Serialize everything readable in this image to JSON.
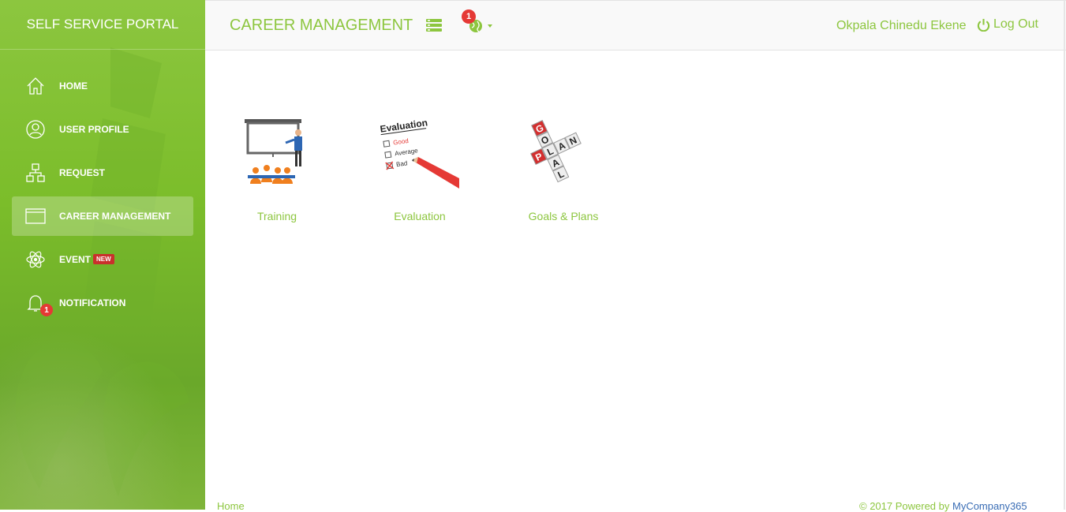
{
  "brand": {
    "title": "SELF SERVICE PORTAL"
  },
  "sidebar": {
    "items": [
      {
        "label": "HOME",
        "icon": "home-icon"
      },
      {
        "label": "USER PROFILE",
        "icon": "user-circle-icon"
      },
      {
        "label": "REQUEST",
        "icon": "sitemap-icon"
      },
      {
        "label": "CAREER MANAGEMENT",
        "icon": "window-icon",
        "active": true
      },
      {
        "label": "EVENT",
        "icon": "atom-icon",
        "badge": "NEW"
      },
      {
        "label": "NOTIFICATION",
        "icon": "bell-icon",
        "count": "1"
      }
    ]
  },
  "header": {
    "title": "CAREER MANAGEMENT",
    "globe_count": "1",
    "user_name": "Okpala Chinedu Ekene",
    "logout_label": "Log Out"
  },
  "tiles": [
    {
      "label": "Training",
      "icon": "training-presentation-image"
    },
    {
      "label": "Evaluation",
      "icon": "evaluation-checklist-image",
      "image_text": {
        "heading": "Evaluation",
        "opt1": "Good",
        "opt2": "Average",
        "opt3": "Bad"
      }
    },
    {
      "label": "Goals & Plans",
      "icon": "goal-plan-cubes-image",
      "image_text": {
        "word1": "GOAL",
        "word2": "PLAN"
      }
    }
  ],
  "footer": {
    "left_link": "Home",
    "right_text": "© 2017 Powered by ",
    "right_link": "MyCompany365"
  },
  "colors": {
    "accent": "#8dc63f",
    "sidebar": "#7bbd2a",
    "badge": "#e53935",
    "new_badge": "#c9302c"
  }
}
